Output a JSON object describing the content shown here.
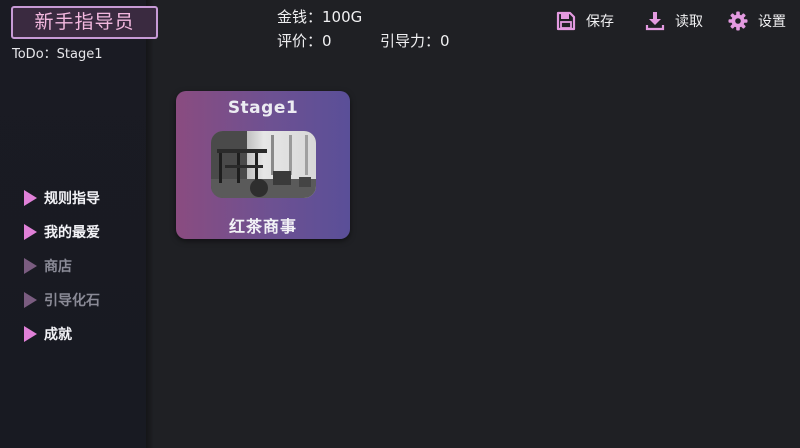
{
  "app": {
    "title": "新手指导员"
  },
  "todo": "ToDo：Stage1",
  "stats": {
    "money": "金钱：100G",
    "rating": "评价：0",
    "guide_power": "引导力：0"
  },
  "toolbar": {
    "save_label": "保存",
    "load_label": "读取",
    "settings_label": "设置"
  },
  "menu": {
    "items": [
      {
        "label": "规则指导",
        "enabled": true
      },
      {
        "label": "我的最爱",
        "enabled": true
      },
      {
        "label": "商店",
        "enabled": false
      },
      {
        "label": "引导化石",
        "enabled": false
      },
      {
        "label": "成就",
        "enabled": true
      }
    ]
  },
  "stage_card": {
    "title": "Stage1",
    "name": "红茶商事"
  },
  "colors": {
    "background": "#1f2024",
    "sidebar": "#1a1b23",
    "accent_pink": "#e080d8",
    "title_border": "#c79ad6",
    "card_gradient_start": "#8a4c80",
    "card_gradient_end": "#5a4f98"
  },
  "icons": {
    "save": "floppy-disk-icon",
    "load": "download-tray-icon",
    "settings": "gear-icon",
    "menu_bullet": "play-triangle-icon"
  }
}
